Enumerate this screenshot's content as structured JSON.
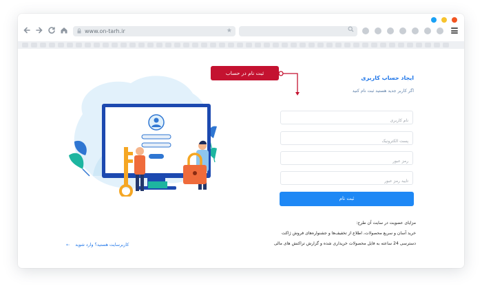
{
  "window": {
    "dot_colors": [
      "#1aa1f5",
      "#f7c32e",
      "#f25522"
    ]
  },
  "browser": {
    "url": "www.on-tarh.ir",
    "nav_icons": [
      "back-arrow-icon",
      "forward-arrow-icon",
      "reload-icon",
      "home-icon"
    ],
    "extension_icons": [
      "cloud-icon",
      "camera-icon",
      "info-icon",
      "gamepad-icon",
      "video-icon",
      "shield-icon",
      "heart-icon"
    ]
  },
  "tag": {
    "label": "ثبت نام در حساب",
    "color": "#c41230"
  },
  "form": {
    "title": "ایجاد حساب کاربری",
    "subtitle": "اگر کاربر جدید هستید ثبت نام کنید",
    "fields": [
      {
        "placeholder": "نام کاربری"
      },
      {
        "placeholder": "پست الکترونیک"
      },
      {
        "placeholder": "رمز عبور"
      },
      {
        "placeholder": "تایید رمز عبور"
      }
    ],
    "submit_label": "ثبت نام",
    "accent": "#1e88f5"
  },
  "benefits": {
    "heading": "مزایای عضویت در سایت آن طرح:",
    "line1": "خرید آسان و سریع محصولات، اطلاع از تخفیف‌ها و جشنواره‌های فروش ژاکت",
    "line2": "دسترسی 24 ساعته به فایل محصولات خریداری شده و گزارش تراکنش های مالی"
  },
  "login_link": "کاربرسایت هستید؟ وارد شوید"
}
